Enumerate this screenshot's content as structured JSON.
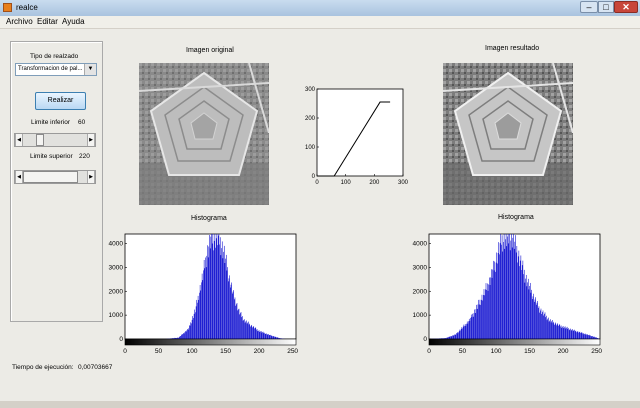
{
  "window": {
    "title": "realce"
  },
  "menu": [
    "Archivo",
    "Editar",
    "Ayuda"
  ],
  "controls": {
    "tipo_label": "Tipo de realzado",
    "tipo_value": "Transformacion de pal...",
    "realizar_label": "Realizar",
    "limite_inferior_label": "Limite inferior",
    "limite_inferior_value": "60",
    "limite_superior_label": "Limite superior",
    "limite_superior_value": "220",
    "slider_inferior_level": 60,
    "slider_superior_level": 220,
    "slider_max": 255
  },
  "tiempo": {
    "label": "Tiempo de ejecución:",
    "value": "0,00703667"
  },
  "titles": {
    "original": "Imagen original",
    "resultado": "Imagen resultado",
    "histograma_left": "Histograma",
    "histograma_right": "Histograma"
  },
  "chart_data": [
    {
      "type": "line",
      "x": [
        0,
        60,
        220,
        255
      ],
      "y": [
        0,
        0,
        255,
        255
      ],
      "xlim": [
        0,
        300
      ],
      "ylim": [
        0,
        300
      ],
      "xticks": [
        "0",
        "100",
        "200",
        "300"
      ],
      "yticks": [
        "0",
        "100",
        "200",
        "300"
      ],
      "color": "#000000"
    },
    {
      "type": "bar",
      "title": "Histograma",
      "x_range": [
        0,
        255
      ],
      "xlim": [
        0,
        255
      ],
      "ylim": [
        0,
        4400
      ],
      "xticks": [
        "0",
        "50",
        "100",
        "150",
        "200",
        "250"
      ],
      "yticks": [
        "0",
        "1000",
        "2000",
        "3000",
        "4000"
      ],
      "profile": [
        [
          0,
          0
        ],
        [
          60,
          0
        ],
        [
          80,
          60
        ],
        [
          95,
          450
        ],
        [
          105,
          1250
        ],
        [
          115,
          2600
        ],
        [
          122,
          3700
        ],
        [
          128,
          4350
        ],
        [
          140,
          4400
        ],
        [
          148,
          3700
        ],
        [
          155,
          2700
        ],
        [
          162,
          1900
        ],
        [
          170,
          1200
        ],
        [
          178,
          800
        ],
        [
          190,
          550
        ],
        [
          200,
          350
        ],
        [
          215,
          180
        ],
        [
          230,
          40
        ],
        [
          240,
          0
        ],
        [
          255,
          0
        ]
      ],
      "color": "#0000cc"
    },
    {
      "type": "bar",
      "title": "Histograma",
      "x_range": [
        0,
        255
      ],
      "xlim": [
        0,
        255
      ],
      "ylim": [
        0,
        4400
      ],
      "xticks": [
        "0",
        "50",
        "100",
        "150",
        "200",
        "250"
      ],
      "yticks": [
        "0",
        "1000",
        "2000",
        "3000",
        "4000"
      ],
      "profile": [
        [
          0,
          0
        ],
        [
          25,
          40
        ],
        [
          40,
          200
        ],
        [
          50,
          500
        ],
        [
          60,
          800
        ],
        [
          70,
          1300
        ],
        [
          80,
          1850
        ],
        [
          90,
          2500
        ],
        [
          100,
          3400
        ],
        [
          108,
          4300
        ],
        [
          125,
          4400
        ],
        [
          135,
          3500
        ],
        [
          145,
          2600
        ],
        [
          155,
          1900
        ],
        [
          165,
          1300
        ],
        [
          180,
          800
        ],
        [
          195,
          580
        ],
        [
          215,
          380
        ],
        [
          235,
          200
        ],
        [
          250,
          60
        ],
        [
          255,
          0
        ]
      ],
      "color": "#0000cc"
    }
  ]
}
